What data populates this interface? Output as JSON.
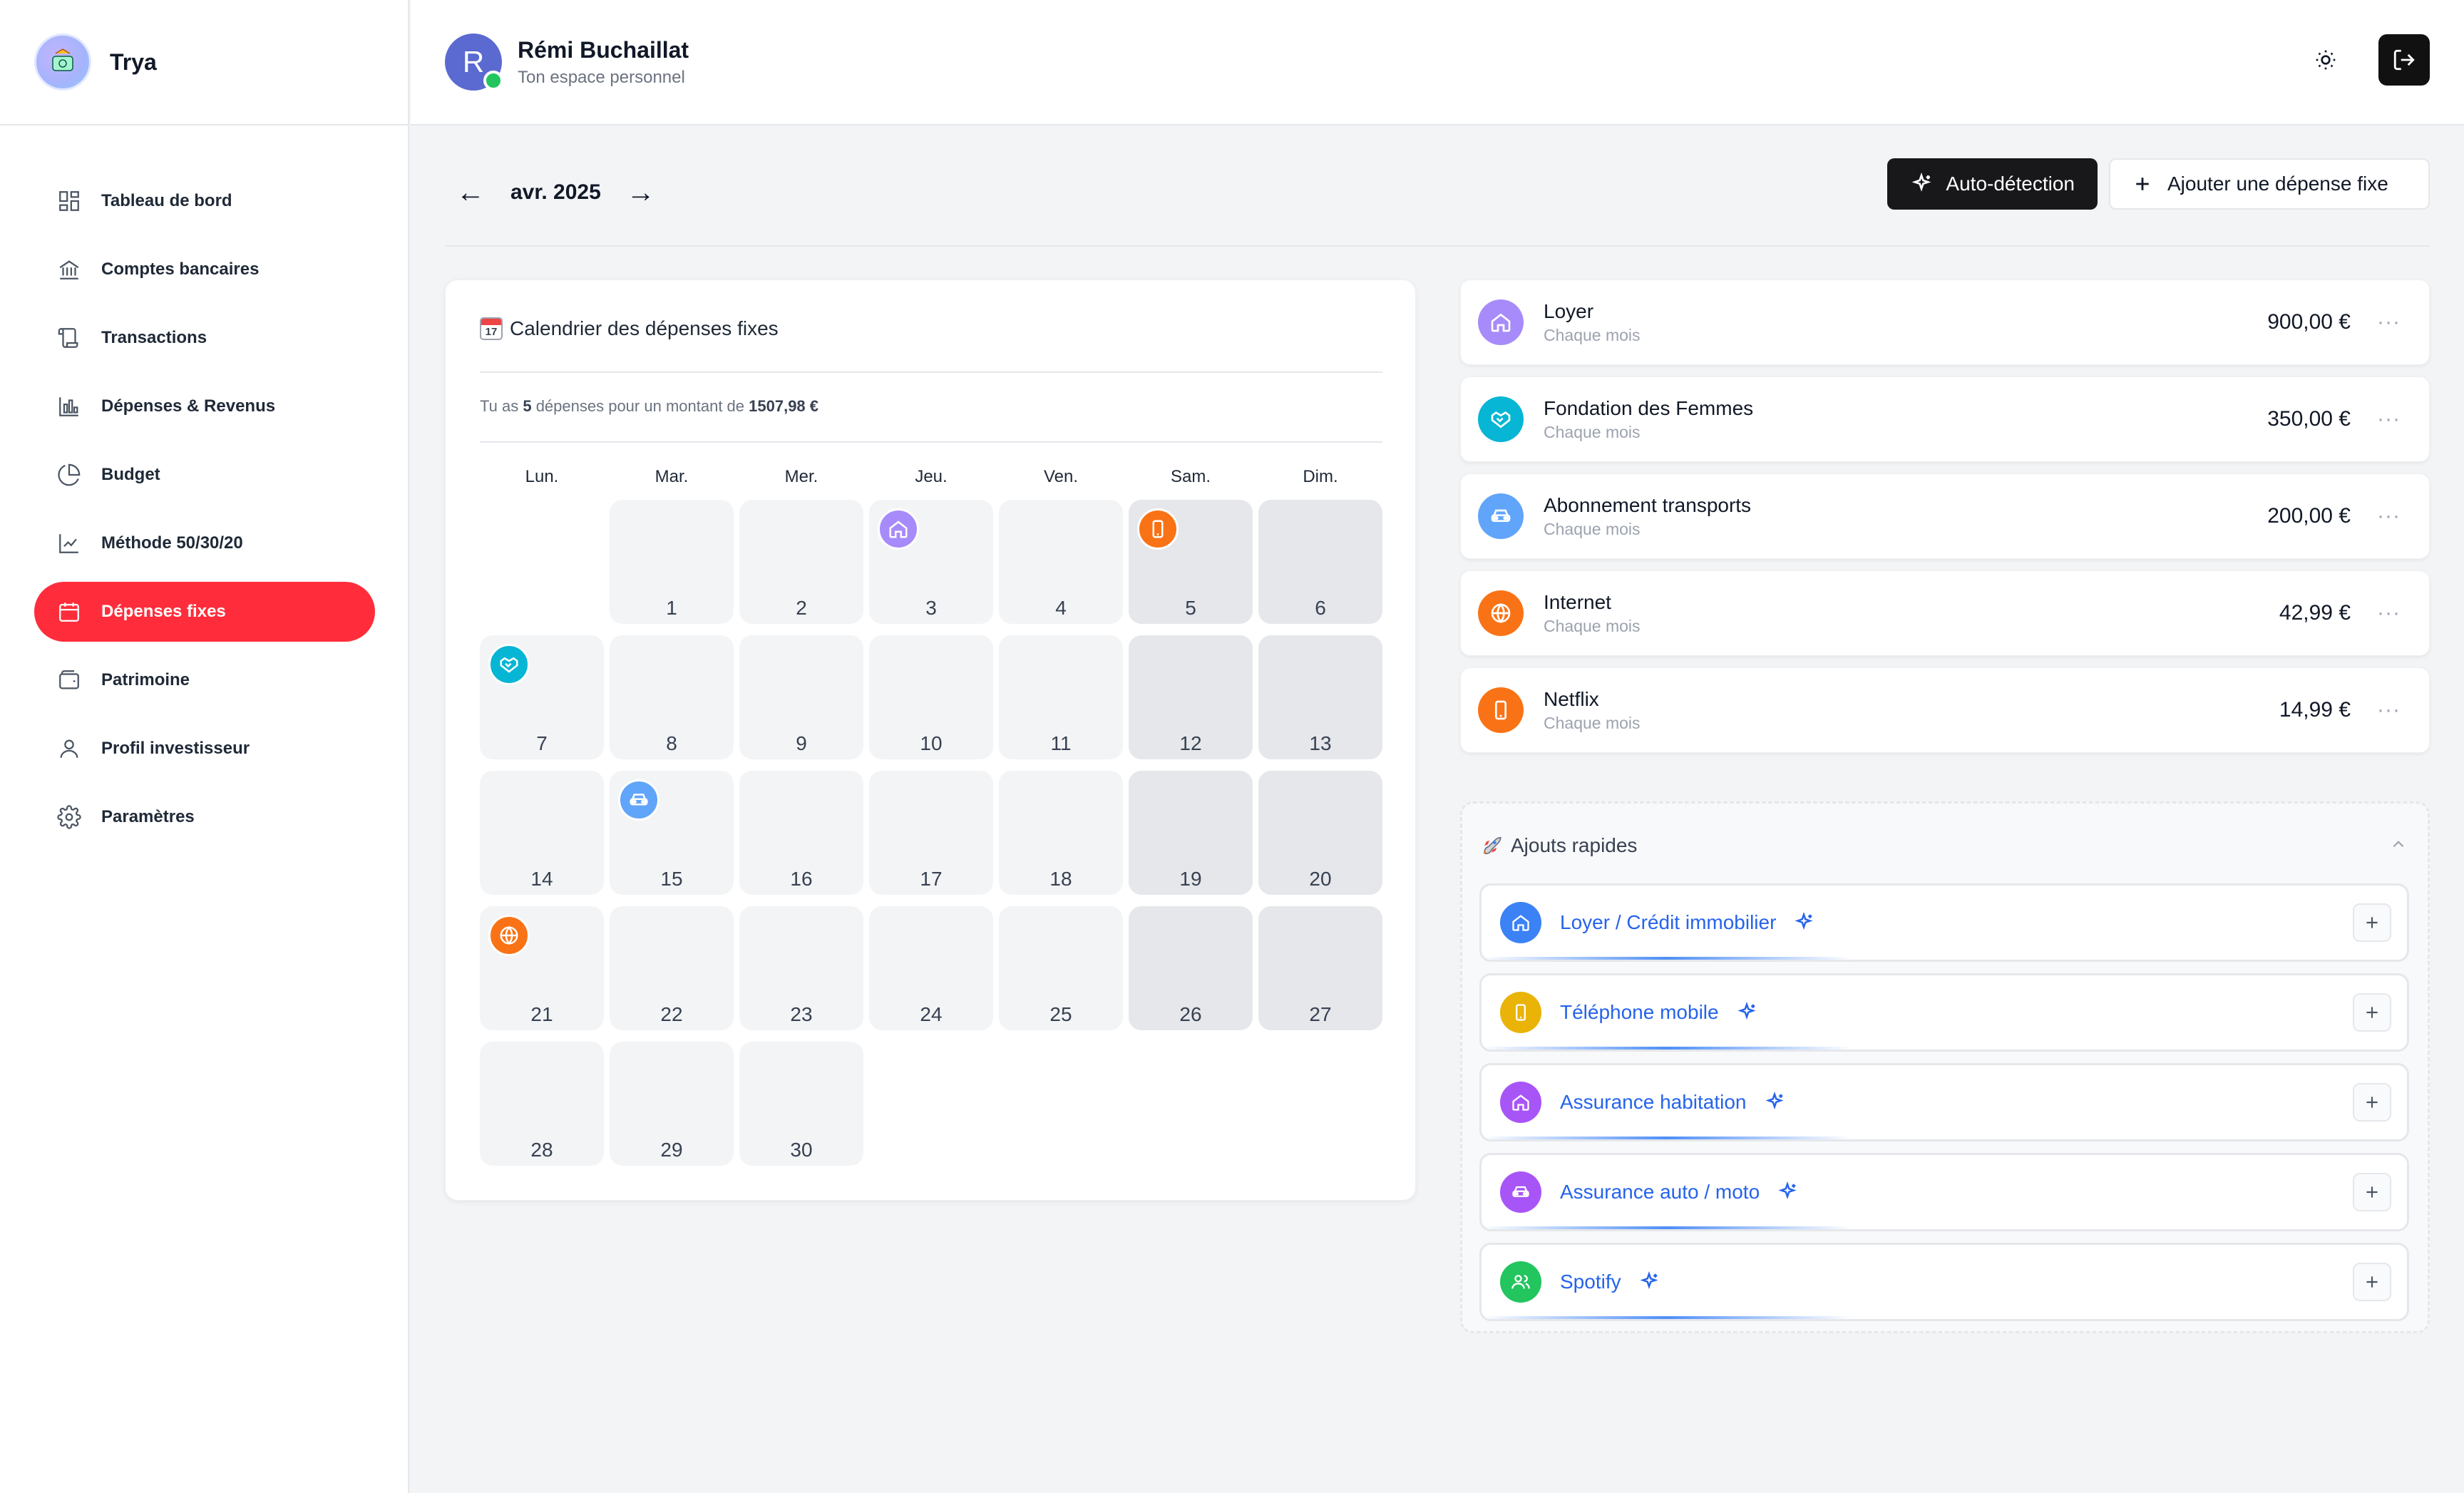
{
  "brand": {
    "name": "Trya"
  },
  "sidebar": {
    "items": [
      {
        "label": "Tableau de bord",
        "icon": "dashboard-icon"
      },
      {
        "label": "Comptes bancaires",
        "icon": "bank-icon"
      },
      {
        "label": "Transactions",
        "icon": "scroll-icon"
      },
      {
        "label": "Dépenses & Revenus",
        "icon": "bar-chart-icon"
      },
      {
        "label": "Budget",
        "icon": "pie-chart-icon"
      },
      {
        "label": "Méthode 50/30/20",
        "icon": "line-chart-icon"
      },
      {
        "label": "Dépenses fixes",
        "icon": "calendar-icon",
        "active": true
      },
      {
        "label": "Patrimoine",
        "icon": "wallet-icon"
      },
      {
        "label": "Profil investisseur",
        "icon": "user-icon"
      },
      {
        "label": "Paramètres",
        "icon": "gear-icon"
      }
    ]
  },
  "header": {
    "avatar_initial": "R",
    "user_name": "Rémi Buchaillat",
    "user_subtitle": "Ton espace personnel"
  },
  "toolbar": {
    "prev_arrow": "←",
    "next_arrow": "→",
    "month": "avr. 2025",
    "auto_detect_label": "Auto-détection",
    "add_fixed_label": "Ajouter une dépense fixe"
  },
  "calendar": {
    "title": "Calendrier des dépenses fixes",
    "emoji_day": "17",
    "summary_prefix": "Tu as ",
    "summary_count": "5",
    "summary_middle": " dépenses pour un montant de ",
    "summary_total": "1507,98 €",
    "weekdays": [
      "Lun.",
      "Mar.",
      "Mer.",
      "Jeu.",
      "Ven.",
      "Sam.",
      "Dim."
    ]
  },
  "expenses": [
    {
      "name": "Loyer",
      "frequency": "Chaque mois",
      "amount": "900,00 €",
      "color": "#a78bfa",
      "icon": "home-icon"
    },
    {
      "name": "Fondation des Femmes",
      "frequency": "Chaque mois",
      "amount": "350,00 €",
      "color": "#06b6d4",
      "icon": "handshake-icon"
    },
    {
      "name": "Abonnement transports",
      "frequency": "Chaque mois",
      "amount": "200,00 €",
      "color": "#60a5fa",
      "icon": "car-icon"
    },
    {
      "name": "Internet",
      "frequency": "Chaque mois",
      "amount": "42,99 €",
      "color": "#f97316",
      "icon": "globe-icon"
    },
    {
      "name": "Netflix",
      "frequency": "Chaque mois",
      "amount": "14,99 €",
      "color": "#f97316",
      "icon": "phone-icon"
    }
  ],
  "expense_more": "···",
  "quick_adds": {
    "title": "Ajouts rapides",
    "items": [
      {
        "label": "Loyer / Crédit immobilier",
        "color": "#3b82f6",
        "icon": "home-icon"
      },
      {
        "label": "Téléphone mobile",
        "color": "#eab308",
        "icon": "phone-icon"
      },
      {
        "label": "Assurance habitation",
        "color": "#a855f7",
        "icon": "home-icon"
      },
      {
        "label": "Assurance auto / moto",
        "color": "#a855f7",
        "icon": "car-icon"
      },
      {
        "label": "Spotify",
        "color": "#22c55e",
        "icon": "users-icon"
      }
    ]
  }
}
